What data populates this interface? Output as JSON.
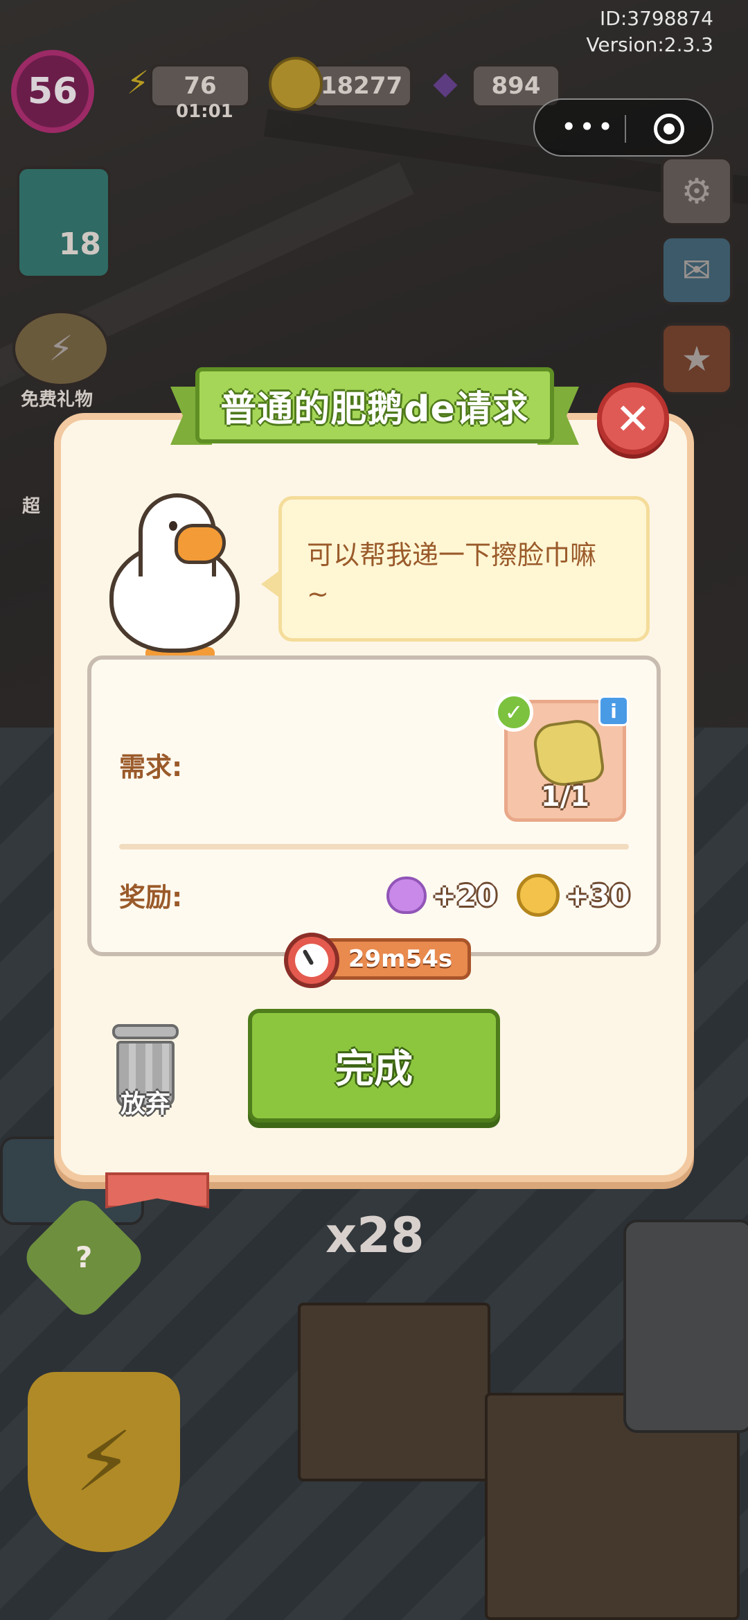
{
  "hud": {
    "user_id": "ID:3798874",
    "version": "Version:2.3.3",
    "level": "56",
    "energy": "76",
    "energy_timer": "01:01",
    "coins": "18277",
    "gems": "894",
    "energy_icon": "lightning-icon",
    "coin_icon": "coin-icon",
    "gem_icon": "gem-icon"
  },
  "sidebar": {
    "task_count": "18",
    "free_gift_label": "免费礼物",
    "super_label_fragment": "超"
  },
  "modal": {
    "title": "普通的肥鹅de请求",
    "speech": "可以帮我递一下擦脸巾嘛 ~",
    "requirement_label": "需求:",
    "required_item": {
      "name": "face-towel",
      "progress": "1/1",
      "completed": true
    },
    "reward_label": "奖励:",
    "rewards": [
      {
        "icon": "heart-icon",
        "amount": "+20",
        "color": "#c889e8"
      },
      {
        "icon": "coin-icon",
        "amount": "+30",
        "color": "#f2c24a"
      }
    ],
    "timer": "29m54s",
    "discard_label": "放弃",
    "complete_label": "完成",
    "close_icon": "close-icon"
  },
  "background": {
    "stack_count": "x28"
  },
  "colors": {
    "title_green": "#a6d657",
    "complete_green": "#8cc63e",
    "close_red": "#e05a55",
    "modal_bg": "#fdf6e6",
    "label_brown": "#9a5a2a"
  }
}
